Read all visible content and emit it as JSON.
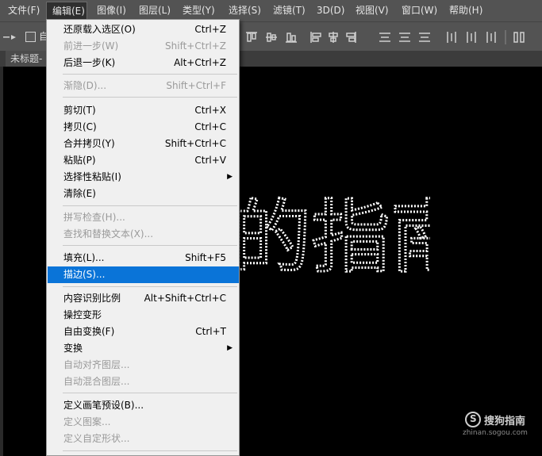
{
  "menubar": {
    "items": [
      {
        "label": "文件(F)"
      },
      {
        "label": "编辑(E)"
      },
      {
        "label": "图像(I)"
      },
      {
        "label": "图层(L)"
      },
      {
        "label": "类型(Y)"
      },
      {
        "label": "选择(S)"
      },
      {
        "label": "滤镜(T)"
      },
      {
        "label": "3D(D)"
      },
      {
        "label": "视图(V)"
      },
      {
        "label": "窗口(W)"
      },
      {
        "label": "帮助(H)"
      }
    ],
    "active_index": 1
  },
  "options": {
    "partial_label": "自"
  },
  "document_tab": {
    "title": "未标题-"
  },
  "canvas": {
    "visible_text": "的指南"
  },
  "edit_menu": {
    "items": [
      {
        "label": "还原载入选区(O)",
        "shortcut": "Ctrl+Z",
        "disabled": false
      },
      {
        "label": "前进一步(W)",
        "shortcut": "Shift+Ctrl+Z",
        "disabled": true
      },
      {
        "label": "后退一步(K)",
        "shortcut": "Alt+Ctrl+Z",
        "disabled": false
      },
      {
        "label": "渐隐(D)...",
        "shortcut": "Shift+Ctrl+F",
        "disabled": true
      },
      {
        "label": "剪切(T)",
        "shortcut": "Ctrl+X",
        "disabled": false
      },
      {
        "label": "拷贝(C)",
        "shortcut": "Ctrl+C",
        "disabled": false
      },
      {
        "label": "合并拷贝(Y)",
        "shortcut": "Shift+Ctrl+C",
        "disabled": false
      },
      {
        "label": "粘贴(P)",
        "shortcut": "Ctrl+V",
        "disabled": false
      },
      {
        "label": "选择性粘贴(I)",
        "shortcut": "",
        "disabled": false,
        "submenu": true
      },
      {
        "label": "清除(E)",
        "shortcut": "",
        "disabled": false
      },
      {
        "label": "拼写检查(H)...",
        "shortcut": "",
        "disabled": true
      },
      {
        "label": "查找和替换文本(X)...",
        "shortcut": "",
        "disabled": true
      },
      {
        "label": "填充(L)...",
        "shortcut": "Shift+F5",
        "disabled": false
      },
      {
        "label": "描边(S)...",
        "shortcut": "",
        "disabled": false,
        "highlighted": true
      },
      {
        "label": "内容识别比例",
        "shortcut": "Alt+Shift+Ctrl+C",
        "disabled": false
      },
      {
        "label": "操控变形",
        "shortcut": "",
        "disabled": false
      },
      {
        "label": "自由变换(F)",
        "shortcut": "Ctrl+T",
        "disabled": false
      },
      {
        "label": "变换",
        "shortcut": "",
        "disabled": false,
        "submenu": true
      },
      {
        "label": "自动对齐图层...",
        "shortcut": "",
        "disabled": true
      },
      {
        "label": "自动混合图层...",
        "shortcut": "",
        "disabled": true
      },
      {
        "label": "定义画笔预设(B)...",
        "shortcut": "",
        "disabled": false
      },
      {
        "label": "定义图案...",
        "shortcut": "",
        "disabled": true
      },
      {
        "label": "定义自定形状...",
        "shortcut": "",
        "disabled": true
      }
    ],
    "submenu_glyph": "▶"
  },
  "watermark": {
    "brand": "搜狗指南",
    "url": "zhinan.sogou.com",
    "logo_letter": "S"
  },
  "colors": {
    "menubar": "#535353",
    "highlight": "#0a74d8",
    "menu_bg": "#f0f0f0"
  }
}
